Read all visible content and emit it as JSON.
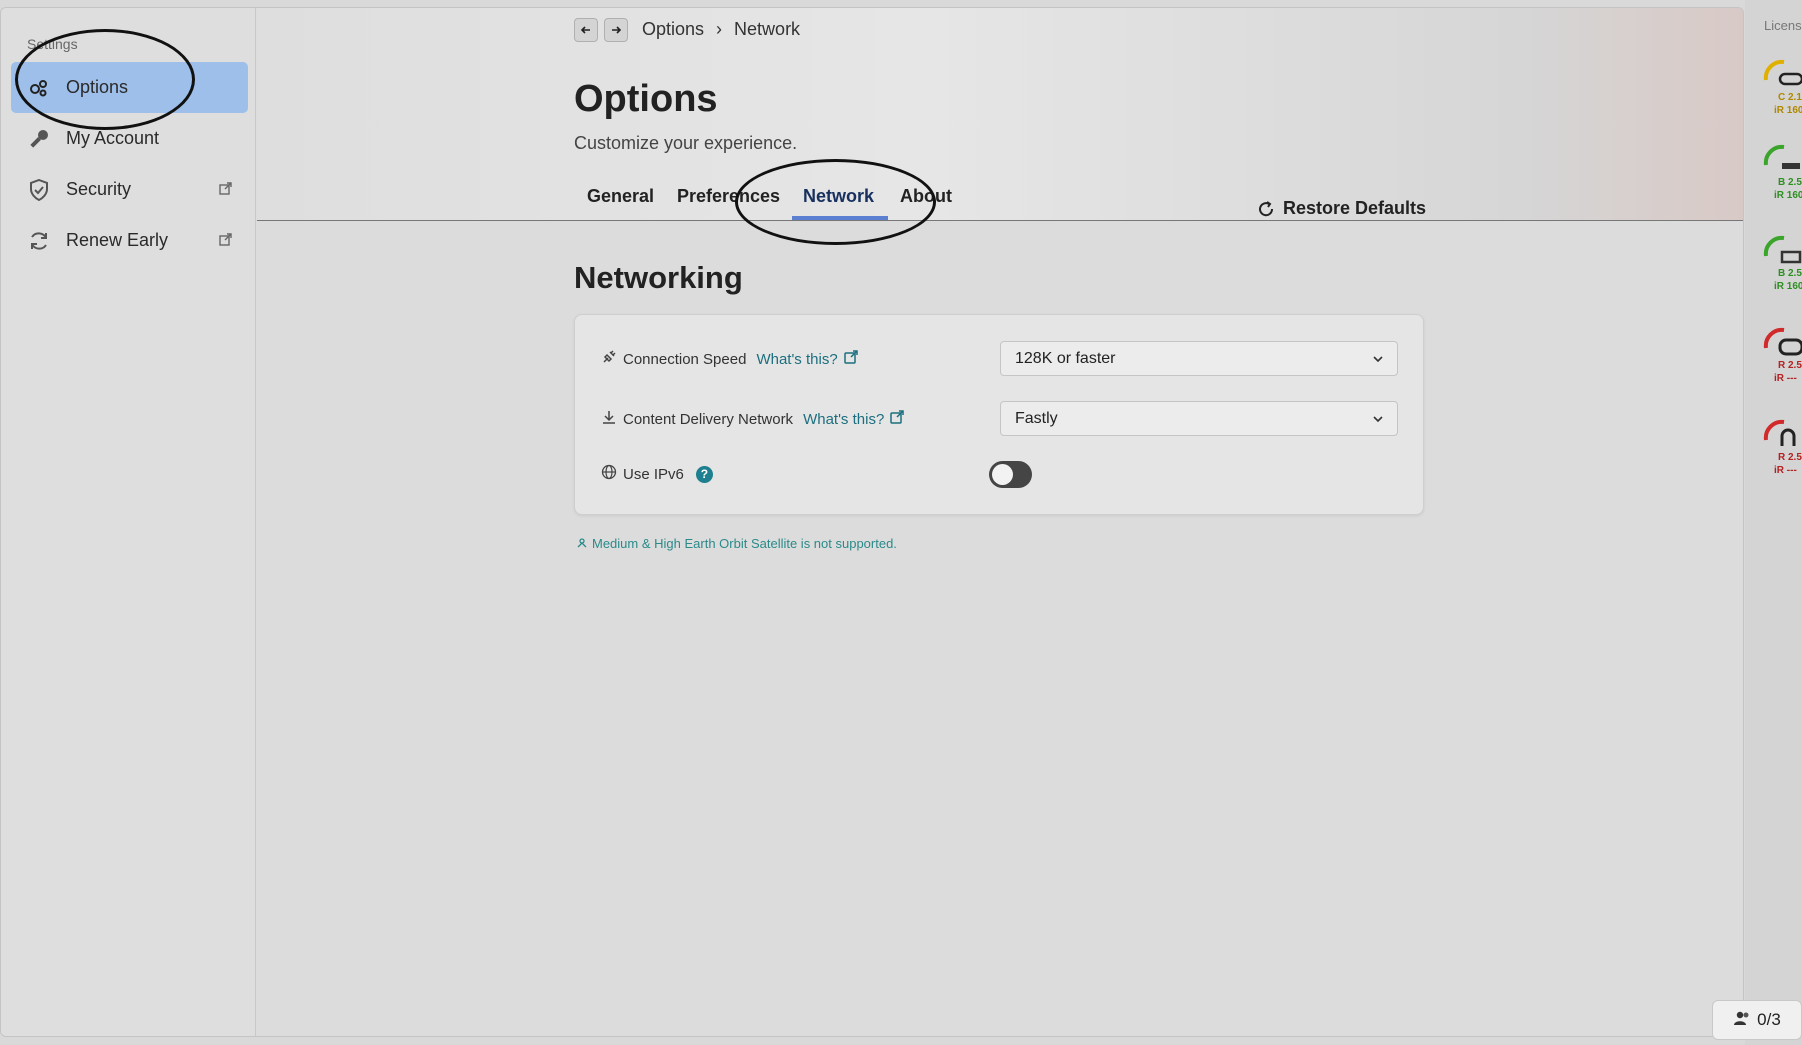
{
  "sidebar": {
    "section_label": "Settings",
    "items": [
      {
        "label": "Options",
        "icon": "gears-icon",
        "active": true,
        "external": false
      },
      {
        "label": "My Account",
        "icon": "key-icon",
        "active": false,
        "external": false
      },
      {
        "label": "Security",
        "icon": "shield-icon",
        "active": false,
        "external": true
      },
      {
        "label": "Renew Early",
        "icon": "refresh-icon",
        "active": false,
        "external": true
      }
    ]
  },
  "breadcrumb": {
    "root": "Options",
    "current": "Network"
  },
  "header": {
    "title": "Options",
    "subtitle": "Customize your experience.",
    "tabs": [
      "General",
      "Preferences",
      "Network",
      "About"
    ],
    "active_tab": "Network",
    "restore_label": "Restore Defaults"
  },
  "section": {
    "title": "Networking",
    "rows": [
      {
        "label": "Connection Speed",
        "help_link": "What's this?",
        "value": "128K or faster",
        "icon": "plug-icon"
      },
      {
        "label": "Content Delivery Network",
        "help_link": "What's this?",
        "value": "Fastly",
        "icon": "download-icon"
      },
      {
        "label": "Use IPv6",
        "toggle_on": false,
        "icon": "globe-icon",
        "help": "?"
      }
    ],
    "note": "Medium & High Earth Orbit Satellite is not supported."
  },
  "right_panel": {
    "title": "Licens",
    "gauges": [
      {
        "line1": "C 2.1",
        "line2": "iR 160",
        "color": "#e0b000"
      },
      {
        "line1": "B 2.5",
        "line2": "iR 160",
        "color": "#3aa52a"
      },
      {
        "line1": "B 2.5",
        "line2": "iR 160",
        "color": "#3aa52a"
      },
      {
        "line1": "R 2.5",
        "line2": "iR ---",
        "color": "#d12a2a"
      },
      {
        "line1": "R 2.5",
        "line2": "iR ---",
        "color": "#d12a2a"
      }
    ]
  },
  "counter": {
    "value": "0/3"
  },
  "colors": {
    "accent": "#5b7fd1",
    "active_bg": "#9dbfe9",
    "link": "#1c6f7f"
  }
}
